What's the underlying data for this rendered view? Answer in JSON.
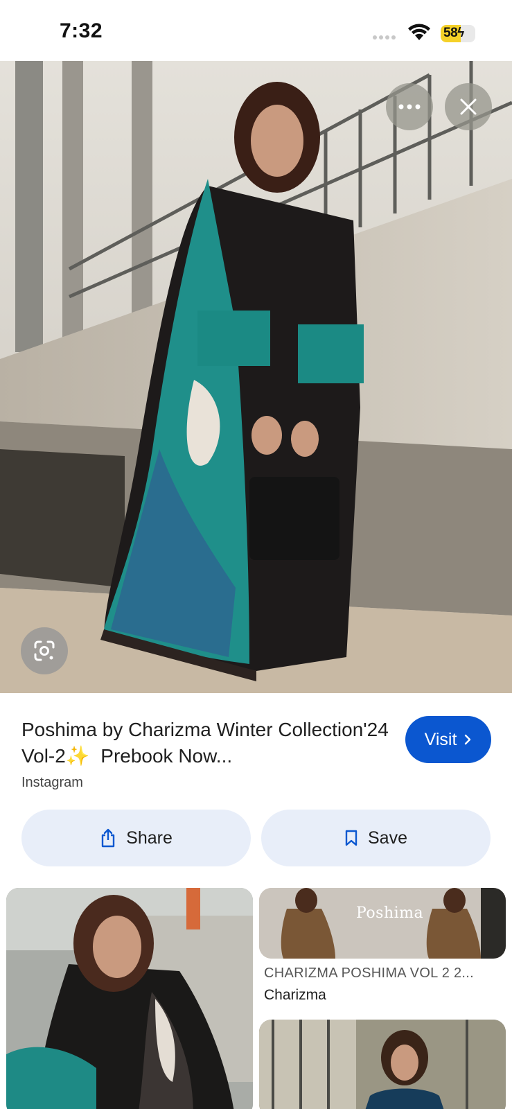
{
  "status_bar": {
    "time": "7:32",
    "battery_level": "58",
    "battery_fraction": 0.58,
    "charging": true,
    "battery_color": "#f5d128"
  },
  "hero": {
    "more_icon": "more-horizontal-icon",
    "close_icon": "close-icon",
    "lens_icon": "google-lens-icon"
  },
  "result": {
    "title_part1": "Poshima by Charizma Winter Collection'24 Vol-2",
    "title_sparkle": "✨",
    "title_part2": "  Prebook Now...",
    "source": "Instagram",
    "visit_label": "Visit",
    "visit_color": "#0b57d0"
  },
  "actions": {
    "share_label": "Share",
    "save_label": "Save"
  },
  "related": {
    "card2_brand": "Poshima",
    "card2_caption": "CHARIZMA POSHIMA VOL 2 2...",
    "card2_source": "Charizma"
  }
}
